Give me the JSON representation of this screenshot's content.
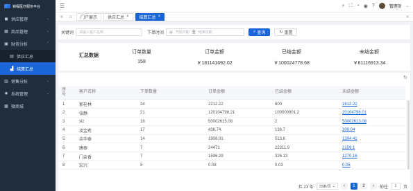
{
  "brand": {
    "name": "锦程医疗服务平台"
  },
  "sidebar": {
    "items": [
      {
        "label": "供应管理",
        "icon": "truck-icon",
        "glyph": "◼"
      },
      {
        "label": "商品管理",
        "icon": "grid-icon",
        "glyph": "▦"
      },
      {
        "label": "财务分析",
        "icon": "money-icon",
        "glyph": "▣"
      }
    ],
    "sub_items": [
      {
        "label": "供应汇总",
        "icon": "doc-icon",
        "glyph": "▤"
      },
      {
        "label": "结算汇总",
        "icon": "chart-icon",
        "glyph": "▟"
      }
    ],
    "bottom_items": [
      {
        "label": "销售分析",
        "icon": "sales-icon",
        "glyph": "▥"
      },
      {
        "label": "系统管理",
        "icon": "gear-icon",
        "glyph": "✹"
      },
      {
        "label": "微商城",
        "icon": "shop-icon",
        "glyph": "▩"
      }
    ]
  },
  "header": {
    "user": "管理员"
  },
  "tabs": [
    {
      "label": "门户展示",
      "closable": false,
      "active": false
    },
    {
      "label": "供应汇总",
      "closable": true,
      "active": false
    },
    {
      "label": "结算汇总",
      "closable": true,
      "active": true
    }
  ],
  "filter": {
    "keyword_label": "关键词",
    "keyword_placeholder": "请输入客户名称",
    "time_label": "下单时间",
    "start_placeholder": "开始日期",
    "to_label": "至",
    "end_placeholder": "结束日期",
    "search_label": "查询",
    "reset_label": "重置"
  },
  "summary": {
    "title": "汇总数据",
    "cols": [
      {
        "head": "订单数量",
        "value": "158"
      },
      {
        "head": "订单金额",
        "value": "￥181141692.02"
      },
      {
        "head": "已结金额",
        "value": "￥100024778.68"
      },
      {
        "head": "未结金额",
        "value": "￥81116913.34"
      }
    ]
  },
  "table": {
    "headers": [
      "序号",
      "客户名称",
      "下单数量",
      "订单金额",
      "已结金额",
      "未结金额"
    ],
    "rows": [
      [
        "1",
        "郭桂林",
        "34",
        "2212.22",
        "600",
        "1612.22"
      ],
      [
        "2",
        "张静",
        "21",
        "120104798.21",
        "100000001.2",
        "20104796.01"
      ],
      [
        "3",
        "xlz",
        "18",
        "50002615.08",
        "2",
        "50002613.08"
      ],
      [
        "4",
        "凌金秀",
        "17",
        "436.74",
        "136.7",
        "300.04"
      ],
      [
        "5",
        "余华泰",
        "14",
        "1908.01",
        "513.6",
        "1394.41"
      ],
      [
        "6",
        "唐泰",
        "7",
        "24471",
        "22311.9",
        "2159.1"
      ],
      [
        "7",
        "门金香",
        "7",
        "1596.29",
        "326.13",
        "1270.16"
      ],
      [
        "8",
        "宏兴",
        "5",
        "0.08",
        "0.03",
        "0.05"
      ]
    ]
  },
  "pager": {
    "total": "共 23 条",
    "page_size": "20条/页",
    "prev": "‹",
    "pages": [
      "1",
      "2"
    ],
    "next": "›",
    "goto_label": "前往",
    "goto_value": "1",
    "page_unit": "页"
  }
}
